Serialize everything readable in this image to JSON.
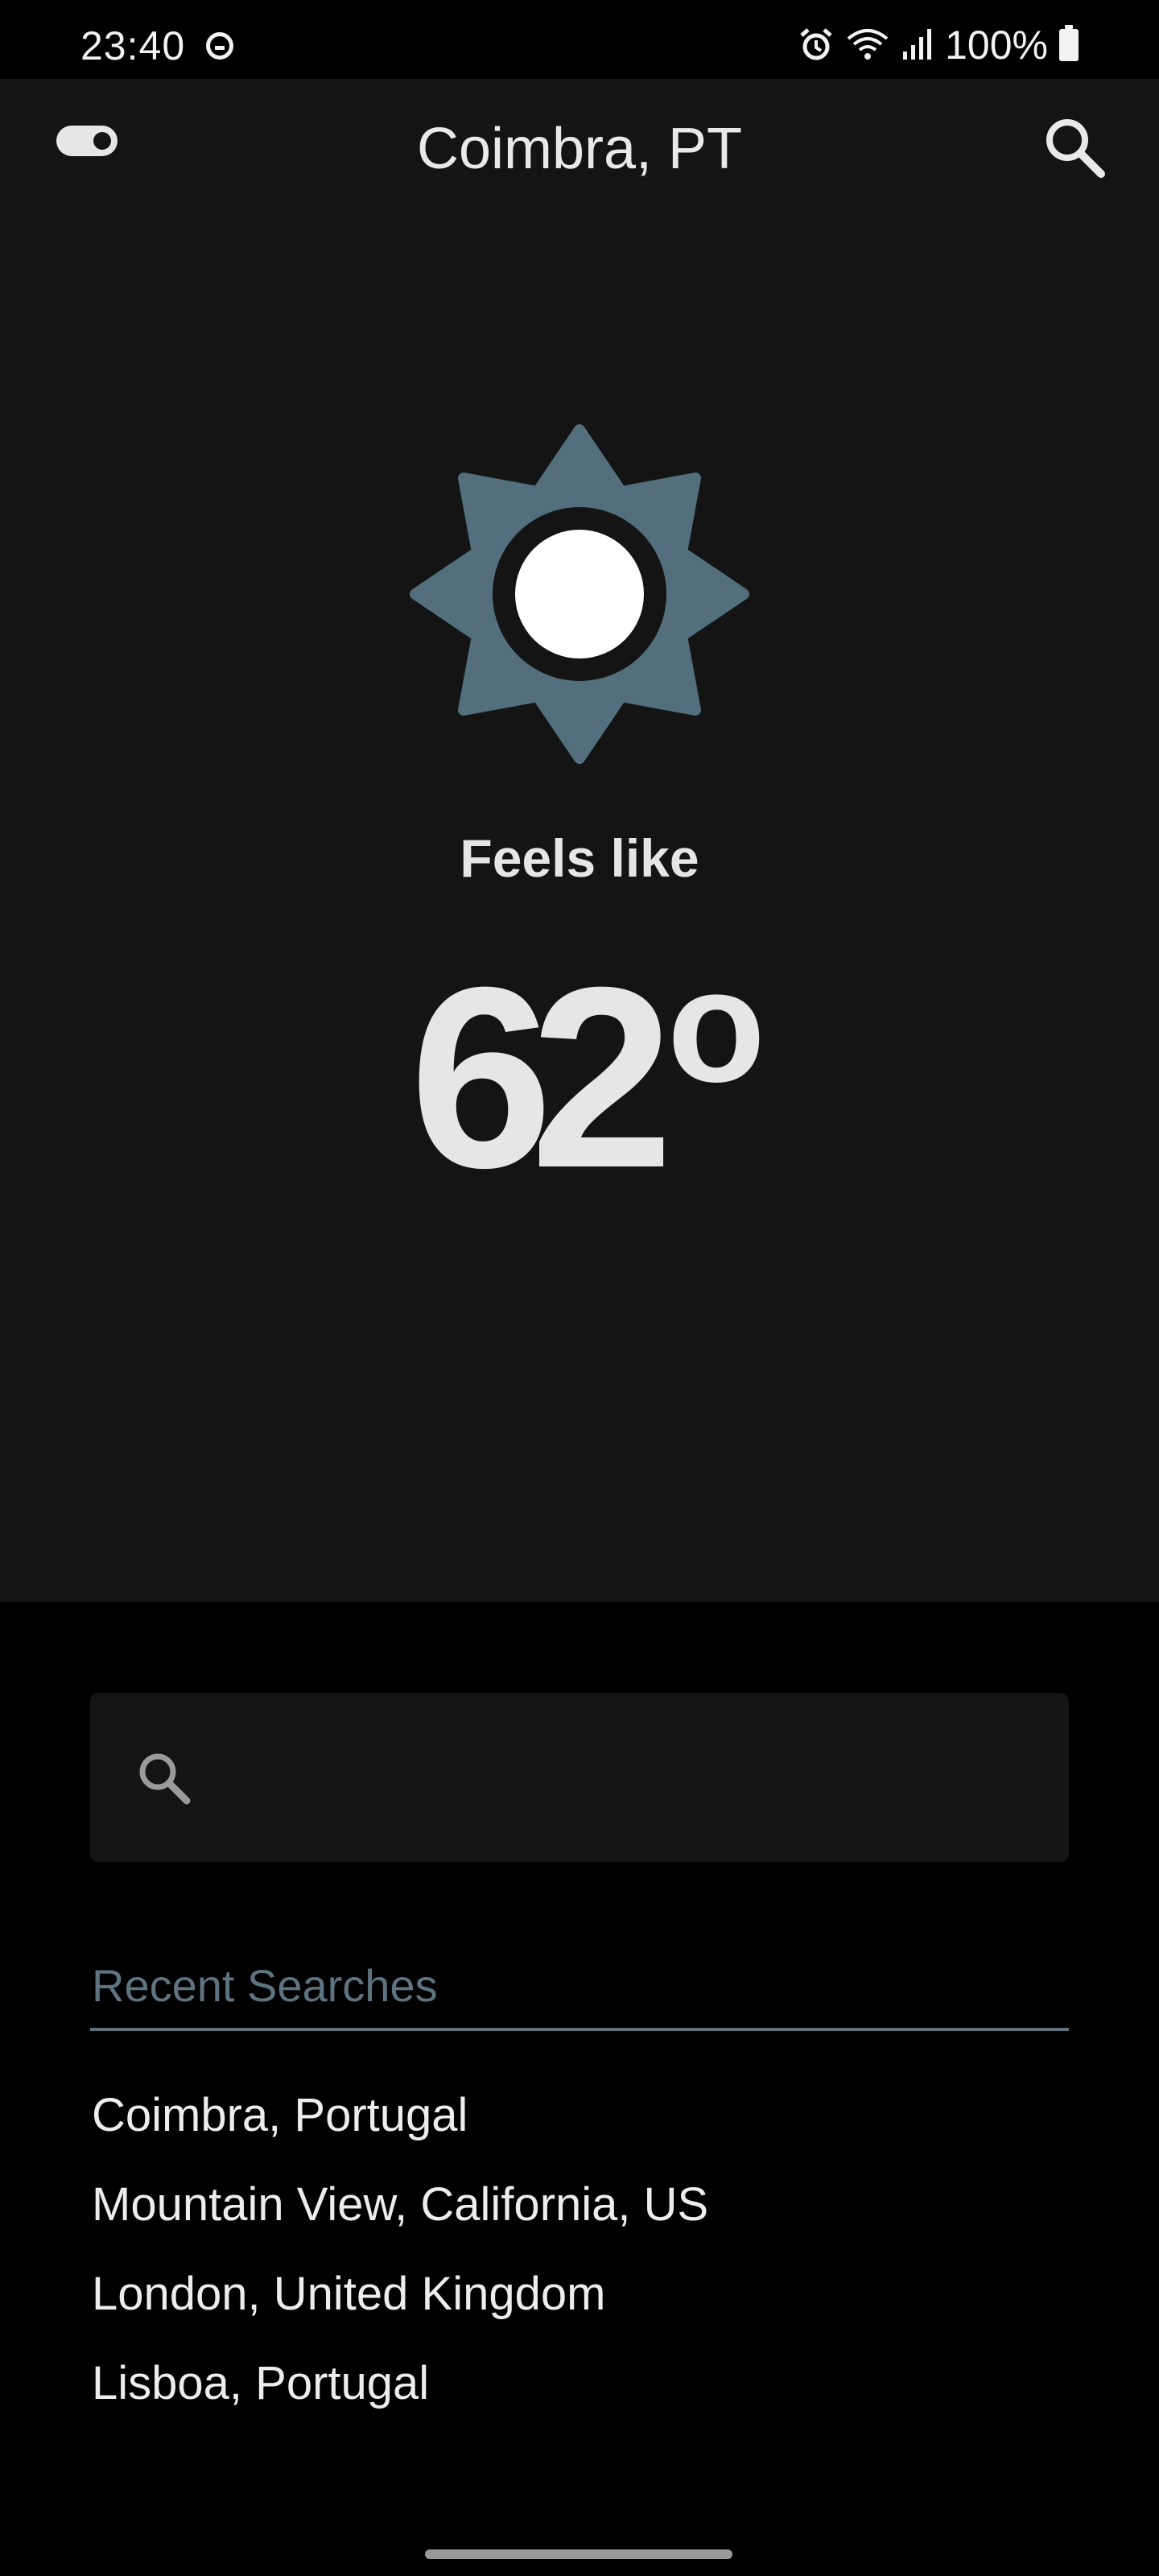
{
  "status_bar": {
    "time": "23:40",
    "battery": "100%",
    "icons": [
      "do-not-disturb-icon",
      "alarm-icon",
      "wifi-icon",
      "signal-icon",
      "battery-icon"
    ]
  },
  "header": {
    "title": "Coimbra, PT",
    "left_icon": "toggle-icon",
    "right_icon": "search-icon"
  },
  "weather": {
    "condition_icon": "sun-icon",
    "feels_like_label": "Feels like",
    "temperature": "62",
    "degree_symbol": "o"
  },
  "search": {
    "icon": "search-icon",
    "value": "",
    "placeholder": ""
  },
  "recent_searches": {
    "heading": "Recent Searches",
    "items": [
      "Coimbra, Portugal",
      "Mountain View, California, US",
      "London, United Kingdom",
      "Lisboa, Portugal"
    ]
  },
  "colors": {
    "background": "#000000",
    "panel": "#141414",
    "accent": "#5e7380",
    "text": "#e6e6e6",
    "sun_rays": "#536f7d"
  }
}
